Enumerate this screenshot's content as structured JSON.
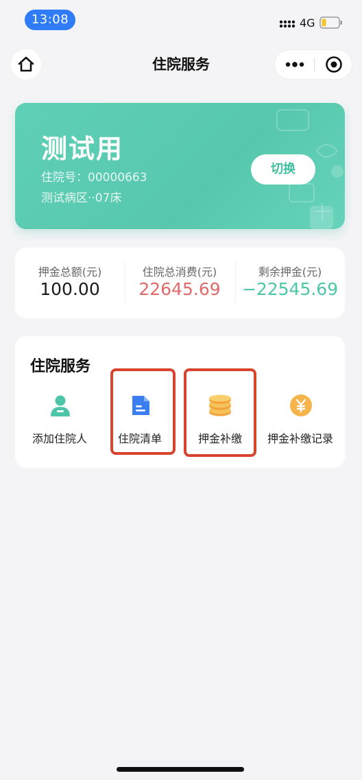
{
  "status_bar": {
    "time": "13:08",
    "network": "4G",
    "icons": [
      "signal-icon",
      "battery-icon"
    ]
  },
  "nav": {
    "title": "住院服务",
    "icons": [
      "home-icon",
      "more-icon",
      "close-circle-icon"
    ]
  },
  "patient": {
    "name": "测试用",
    "admission_line": "住院号：00000663",
    "ward_line": "测试病区··07床",
    "switch_label": "切换"
  },
  "stats": [
    {
      "label": "押金总额(元)",
      "value": "100.00",
      "color": "#1a1a1a"
    },
    {
      "label": "住院总消费(元)",
      "value": "22645.69",
      "color": "#e06a6a"
    },
    {
      "label": "剩余押金(元)",
      "value": "−22545.69",
      "color": "#4cc5a8"
    }
  ],
  "services": {
    "title": "住院服务",
    "items": [
      {
        "label": "添加住院人",
        "icon": "person-add-icon"
      },
      {
        "label": "住院清单",
        "icon": "document-icon"
      },
      {
        "label": "押金补缴",
        "icon": "coins-icon"
      },
      {
        "label": "押金补缴记录",
        "icon": "yuan-coin-icon"
      }
    ]
  },
  "colors": {
    "accent_green": "#5fd0b6",
    "status_blue": "#2f7cf6",
    "highlight_red": "#d8432d"
  }
}
